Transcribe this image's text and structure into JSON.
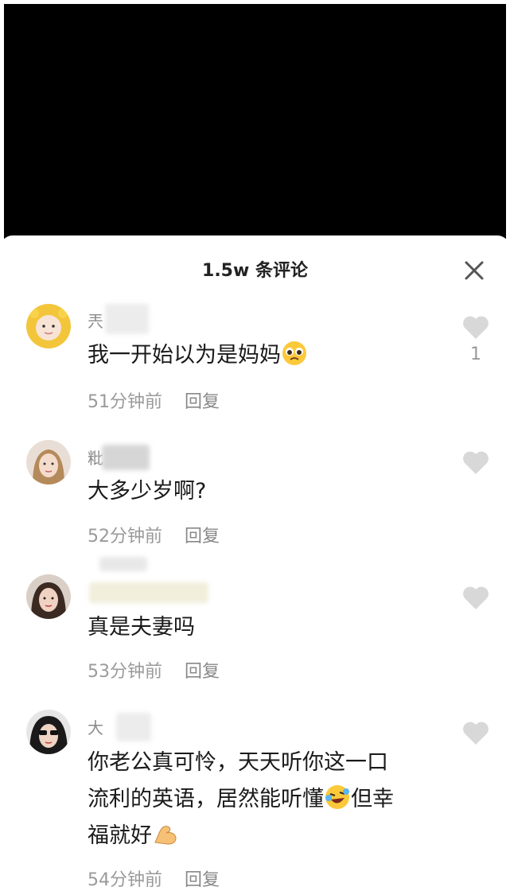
{
  "header": {
    "title": "1.5w 条评论"
  },
  "comments": [
    {
      "name_glyph": "兲",
      "text": "我一开始以为是妈妈",
      "time": "51分钟前",
      "reply": "回复",
      "likes": "1"
    },
    {
      "name_glyph": "粃",
      "text": "大多少岁啊?",
      "time": "52分钟前",
      "reply": "回复",
      "likes": ""
    },
    {
      "name_glyph": "",
      "text": "真是夫妻吗",
      "time": "53分钟前",
      "reply": "回复",
      "likes": ""
    },
    {
      "name_glyph": "大",
      "text_line1": "你老公真可怜，天天听你这一口",
      "text_line2a": "流利的英语，居然能听懂",
      "text_line2b": "但幸",
      "text_line3": "福就好",
      "time": "54分钟前",
      "reply": "回复",
      "likes": ""
    }
  ],
  "icons": {
    "close": "close-icon",
    "like": "heart-icon"
  },
  "colors": {
    "video_bg": "#000000",
    "sheet_bg": "#ffffff",
    "meta": "#9a9a9a",
    "heart": "#d8d8d8"
  }
}
